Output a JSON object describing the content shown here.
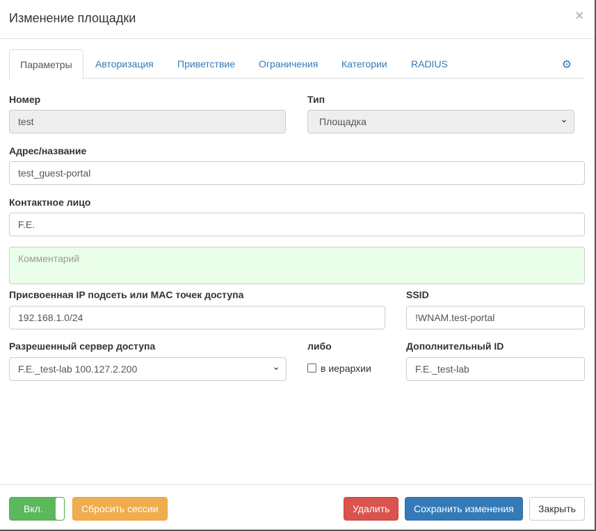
{
  "title": "Изменение площадки",
  "close": "×",
  "tabs": [
    "Параметры",
    "Авторизация",
    "Приветствие",
    "Ограничения",
    "Категории",
    "RADIUS"
  ],
  "fields": {
    "number_label": "Номер",
    "number_value": "test",
    "type_label": "Тип",
    "type_value": "Площадка",
    "address_label": "Адрес/название",
    "address_value": "test_guest-portal",
    "contact_label": "Контактное лицо",
    "contact_value": "F.E.",
    "comment_placeholder": "Комментарий",
    "subnet_label": "Присвоенная IP подсеть или MAC точек доступа",
    "subnet_value": "192.168.1.0/24",
    "ssid_label": "SSID",
    "ssid_value": "!WNAM.test-portal",
    "server_label": "Разрешенный сервер доступа",
    "server_value": "F.E._test-lab 100.127.2.200",
    "or_label": "либо",
    "hierarchy_label": "в иерархии",
    "extra_id_label": "Дополнительный ID",
    "extra_id_value": "F.E._test-lab"
  },
  "footer": {
    "toggle": "Вкл.",
    "reset": "Сбросить сессии",
    "delete": "Удалить",
    "save": "Сохранить изменения",
    "close": "Закрыть"
  }
}
